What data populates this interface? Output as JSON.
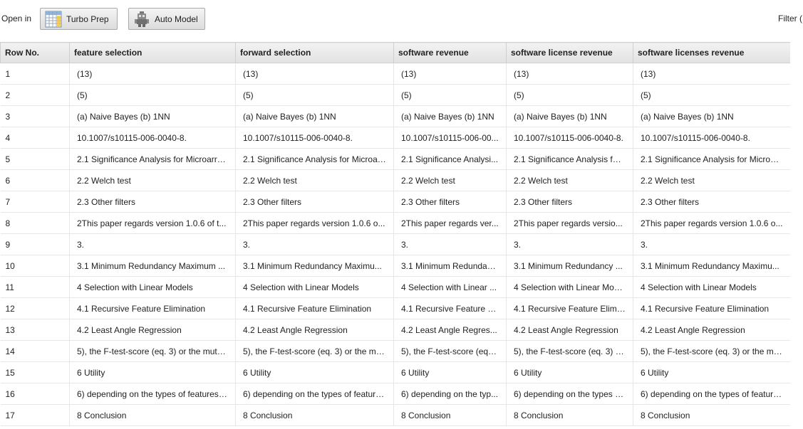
{
  "toolbar": {
    "open_in_label": "Open in",
    "turbo_prep_label": "Turbo Prep",
    "auto_model_label": "Auto Model",
    "filter_label": "Filter ("
  },
  "table": {
    "columns": [
      "Row No.",
      "feature selection",
      "forward selection",
      "software revenue",
      "software license revenue",
      "software licenses revenue"
    ],
    "rows": [
      [
        "1",
        "(13)",
        "(13)",
        "(13)",
        "(13)",
        "(13)"
      ],
      [
        "2",
        "(5)",
        "(5)",
        "(5)",
        "(5)",
        "(5)"
      ],
      [
        "3",
        "(a) Naive Bayes (b) 1NN",
        "(a) Naive Bayes (b) 1NN",
        "(a) Naive Bayes (b) 1NN",
        "(a) Naive Bayes (b) 1NN",
        "(a) Naive Bayes (b) 1NN"
      ],
      [
        "4",
        "10.1007/s10115-006-0040-8.",
        "10.1007/s10115-006-0040-8.",
        "10.1007/s10115-006-00...",
        "10.1007/s10115-006-0040-8.",
        "10.1007/s10115-006-0040-8."
      ],
      [
        "5",
        "2.1 Significance Analysis for Microarra...",
        "2.1 Significance Analysis for Microar...",
        "2.1 Significance Analysi...",
        "2.1 Significance Analysis for...",
        "2.1 Significance Analysis for Microar..."
      ],
      [
        "6",
        "2.2 Welch test",
        "2.2 Welch test",
        "2.2 Welch test",
        "2.2 Welch test",
        "2.2 Welch test"
      ],
      [
        "7",
        "2.3 Other filters",
        "2.3 Other filters",
        "2.3 Other filters",
        "2.3 Other filters",
        "2.3 Other filters"
      ],
      [
        "8",
        "2This paper regards version 1.0.6 of t...",
        "2This paper regards version 1.0.6 o...",
        "2This paper regards ver...",
        "2This paper regards versio...",
        "2This paper regards version 1.0.6 o..."
      ],
      [
        "9",
        "3.",
        "3.",
        "3.",
        "3.",
        "3."
      ],
      [
        "10",
        "3.1 Minimum Redundancy Maximum ...",
        "3.1 Minimum Redundancy Maximu...",
        "3.1 Minimum Redundan...",
        "3.1 Minimum Redundancy ...",
        "3.1 Minimum Redundancy Maximu..."
      ],
      [
        "11",
        "4 Selection with Linear Models",
        "4 Selection with Linear Models",
        "4 Selection with Linear ...",
        "4 Selection with Linear Mod...",
        "4 Selection with Linear Models"
      ],
      [
        "12",
        "4.1 Recursive Feature Elimination",
        "4.1 Recursive Feature Elimination",
        "4.1 Recursive Feature E...",
        "4.1 Recursive Feature Elimi...",
        "4.1 Recursive Feature Elimination"
      ],
      [
        "13",
        "4.2 Least Angle Regression",
        "4.2 Least Angle Regression",
        "4.2 Least Angle Regres...",
        "4.2 Least Angle Regression",
        "4.2 Least Angle Regression"
      ],
      [
        "14",
        "5), the F-test-score (eq. 3) or the mutu...",
        "5), the F-test-score (eq. 3) or the mu...",
        "5), the F-test-score (eq. ...",
        "5), the F-test-score (eq. 3) o...",
        "5), the F-test-score (eq. 3) or the mu..."
      ],
      [
        "15",
        "6 Utility",
        "6 Utility",
        "6 Utility",
        "6 Utility",
        "6 Utility"
      ],
      [
        "16",
        "6) depending on the types of features ...",
        "6) depending on the types of feature...",
        "6) depending on the typ...",
        "6) depending on the types o...",
        "6) depending on the types of feature..."
      ],
      [
        "17",
        "8 Conclusion",
        "8 Conclusion",
        "8 Conclusion",
        "8 Conclusion",
        "8 Conclusion"
      ]
    ]
  }
}
